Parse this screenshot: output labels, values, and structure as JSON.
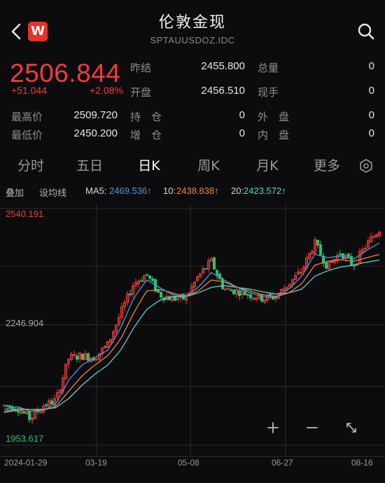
{
  "header": {
    "title": "伦敦金现",
    "code": "SPTAUUSDOZ.IDC",
    "logo_letter": "W"
  },
  "quote": {
    "price": "2506.844",
    "change": "+51.044",
    "change_pct": "+2.08%",
    "fields": [
      {
        "label": "昨结",
        "value": "2455.800"
      },
      {
        "label": "总量",
        "value": "0"
      },
      {
        "label": "开盘",
        "value": "2456.510"
      },
      {
        "label": "现手",
        "value": "0"
      },
      {
        "label": "最高价",
        "value": "2509.720"
      },
      {
        "label": "持　仓",
        "value": "0"
      },
      {
        "label": "外　盘",
        "value": "0"
      },
      {
        "label": "最低价",
        "value": "2450.200"
      },
      {
        "label": "增　仓",
        "value": "0"
      },
      {
        "label": "内　盘",
        "value": "0"
      }
    ]
  },
  "tabs": [
    "分时",
    "五日",
    "日K",
    "周K",
    "月K",
    "更多"
  ],
  "active_tab": "日K",
  "indicators": {
    "overlay": "叠加",
    "set_line": "设均线",
    "ma5_label": "MA5:",
    "ma5": "2469.536↑",
    "ma10_label": "10:",
    "ma10": "2438.838↑",
    "ma20_label": "20:",
    "ma20": "2423.572↑"
  },
  "colors": {
    "up": "#f23b3b",
    "down": "#27c26c",
    "ma5": "#4a9bd6",
    "ma10": "#e9883a",
    "ma20": "#5fd0c9",
    "background": "#0c0c0e"
  },
  "chart_data": {
    "type": "candlestick",
    "y_labels": {
      "high": "2540.191",
      "mid": "2246.904",
      "low": "1953.617"
    },
    "ylim": [
      1953.617,
      2540.191
    ],
    "x_labels": [
      "2024-01-29",
      "03-19",
      "05-08",
      "06-27",
      "08-16"
    ],
    "close_path": [
      [
        "2024-01-29",
        2030
      ],
      [
        "2024-02-05",
        2025
      ],
      [
        "2024-02-12",
        1995
      ],
      [
        "2024-02-19",
        2030
      ],
      [
        "2024-02-26",
        2045
      ],
      [
        "2024-03-04",
        2160
      ],
      [
        "2024-03-11",
        2165
      ],
      [
        "2024-03-19",
        2160
      ],
      [
        "2024-03-26",
        2195
      ],
      [
        "2024-04-02",
        2280
      ],
      [
        "2024-04-09",
        2360
      ],
      [
        "2024-04-16",
        2385
      ],
      [
        "2024-04-22",
        2330
      ],
      [
        "2024-04-29",
        2320
      ],
      [
        "2024-05-06",
        2320
      ],
      [
        "2024-05-13",
        2380
      ],
      [
        "2024-05-20",
        2420
      ],
      [
        "2024-05-27",
        2345
      ],
      [
        "2024-06-03",
        2340
      ],
      [
        "2024-06-10",
        2330
      ],
      [
        "2024-06-17",
        2320
      ],
      [
        "2024-06-24",
        2325
      ],
      [
        "2024-07-01",
        2360
      ],
      [
        "2024-07-08",
        2395
      ],
      [
        "2024-07-15",
        2470
      ],
      [
        "2024-07-22",
        2405
      ],
      [
        "2024-07-29",
        2445
      ],
      [
        "2024-08-05",
        2410
      ],
      [
        "2024-08-12",
        2465
      ],
      [
        "2024-08-16",
        2506.844
      ]
    ],
    "ma5_path": [
      2020,
      2028,
      2015,
      2018,
      2035,
      2100,
      2140,
      2160,
      2180,
      2240,
      2320,
      2370,
      2350,
      2330,
      2325,
      2350,
      2390,
      2370,
      2350,
      2335,
      2325,
      2322,
      2345,
      2380,
      2440,
      2430,
      2435,
      2425,
      2450,
      2470
    ],
    "ma10_path": [
      2015,
      2022,
      2020,
      2018,
      2028,
      2070,
      2110,
      2140,
      2165,
      2210,
      2280,
      2340,
      2345,
      2335,
      2325,
      2340,
      2370,
      2365,
      2350,
      2340,
      2330,
      2325,
      2335,
      2360,
      2410,
      2420,
      2425,
      2420,
      2430,
      2439
    ],
    "ma20_path": [
      2012,
      2018,
      2020,
      2020,
      2025,
      2050,
      2085,
      2115,
      2140,
      2180,
      2240,
      2290,
      2315,
      2325,
      2325,
      2335,
      2350,
      2355,
      2350,
      2345,
      2338,
      2332,
      2335,
      2345,
      2380,
      2395,
      2405,
      2410,
      2418,
      2424
    ]
  },
  "icons": {
    "back": "back-arrow-icon",
    "search": "search-icon",
    "settings": "settings-icon",
    "zoom_in": "plus-icon",
    "zoom_out": "minus-icon",
    "fullscreen": "expand-icon"
  }
}
